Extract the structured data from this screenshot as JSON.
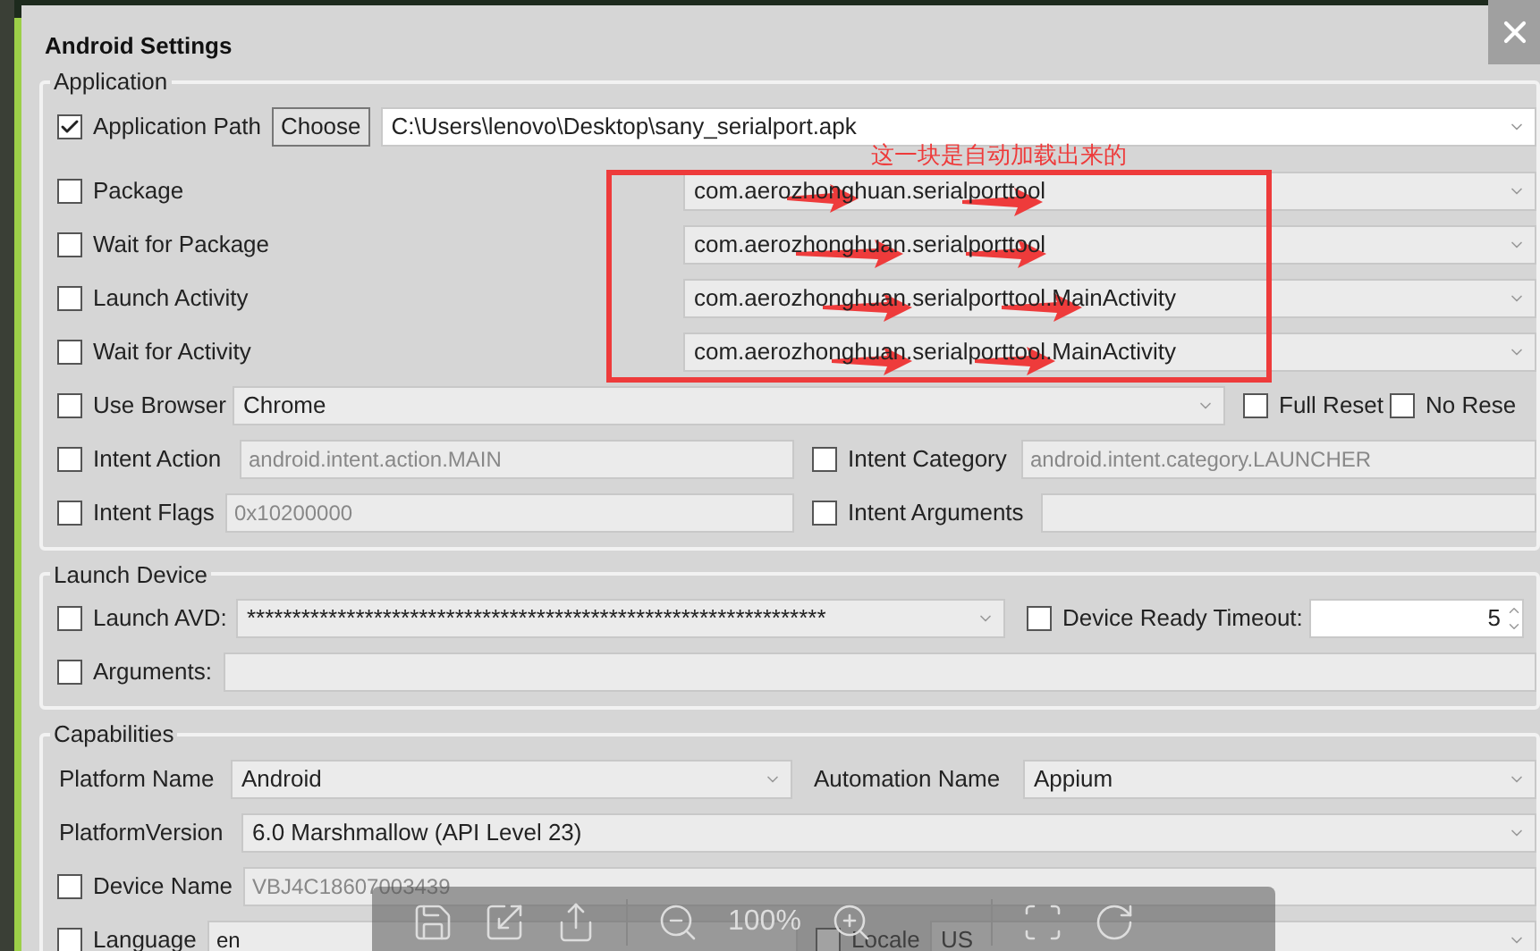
{
  "window": {
    "title": "Android Settings"
  },
  "application": {
    "legend": "Application",
    "app_path": {
      "label": "Application Path",
      "checked": true,
      "button": "Choose",
      "value": "C:\\Users\\lenovo\\Desktop\\sany_serialport.apk"
    },
    "package_rows": [
      {
        "label": "Package",
        "checked": false,
        "value": "com.aerozhonghuan.serialporttool"
      },
      {
        "label": "Wait for Package",
        "checked": false,
        "value": "com.aerozhonghuan.serialporttool"
      },
      {
        "label": "Launch Activity",
        "checked": false,
        "value": "com.aerozhonghuan.serialporttool.MainActivity"
      },
      {
        "label": "Wait for Activity",
        "checked": false,
        "value": "com.aerozhonghuan.serialporttool.MainActivity"
      }
    ],
    "use_browser": {
      "label": "Use Browser",
      "checked": false,
      "value": "Chrome"
    },
    "full_reset": {
      "label": "Full Reset",
      "checked": false
    },
    "no_reset": {
      "label": "No Rese",
      "checked": false
    },
    "intent_action": {
      "label": "Intent Action",
      "checked": false,
      "placeholder": "android.intent.action.MAIN"
    },
    "intent_category": {
      "label": "Intent Category",
      "checked": false,
      "placeholder": "android.intent.category.LAUNCHER"
    },
    "intent_flags": {
      "label": "Intent Flags",
      "checked": false,
      "placeholder": "0x10200000"
    },
    "intent_arguments": {
      "label": "Intent Arguments",
      "checked": false
    }
  },
  "annotation": {
    "text": "这一块是自动加载出来的"
  },
  "launch_device": {
    "legend": "Launch Device",
    "launch_avd": {
      "label": "Launch AVD:",
      "checked": false,
      "value": "****************************************************************"
    },
    "device_ready_timeout": {
      "label": "Device Ready Timeout:",
      "checked": false,
      "value": "5"
    },
    "arguments": {
      "label": "Arguments:",
      "checked": false
    }
  },
  "capabilities": {
    "legend": "Capabilities",
    "platform_name": {
      "label": "Platform Name",
      "value": "Android"
    },
    "automation_name": {
      "label": "Automation Name",
      "value": "Appium"
    },
    "platform_version": {
      "label": "PlatformVersion",
      "value": "6.0 Marshmallow (API Level 23)"
    },
    "device_name": {
      "label": "Device Name",
      "checked": false,
      "placeholder": "VBJ4C18607003439"
    },
    "language": {
      "label": "Language",
      "checked": false,
      "value": "en"
    },
    "locale": {
      "label": "Locale",
      "checked": false,
      "value": "US"
    }
  },
  "viewer_toolbar": {
    "zoom": "100%"
  }
}
